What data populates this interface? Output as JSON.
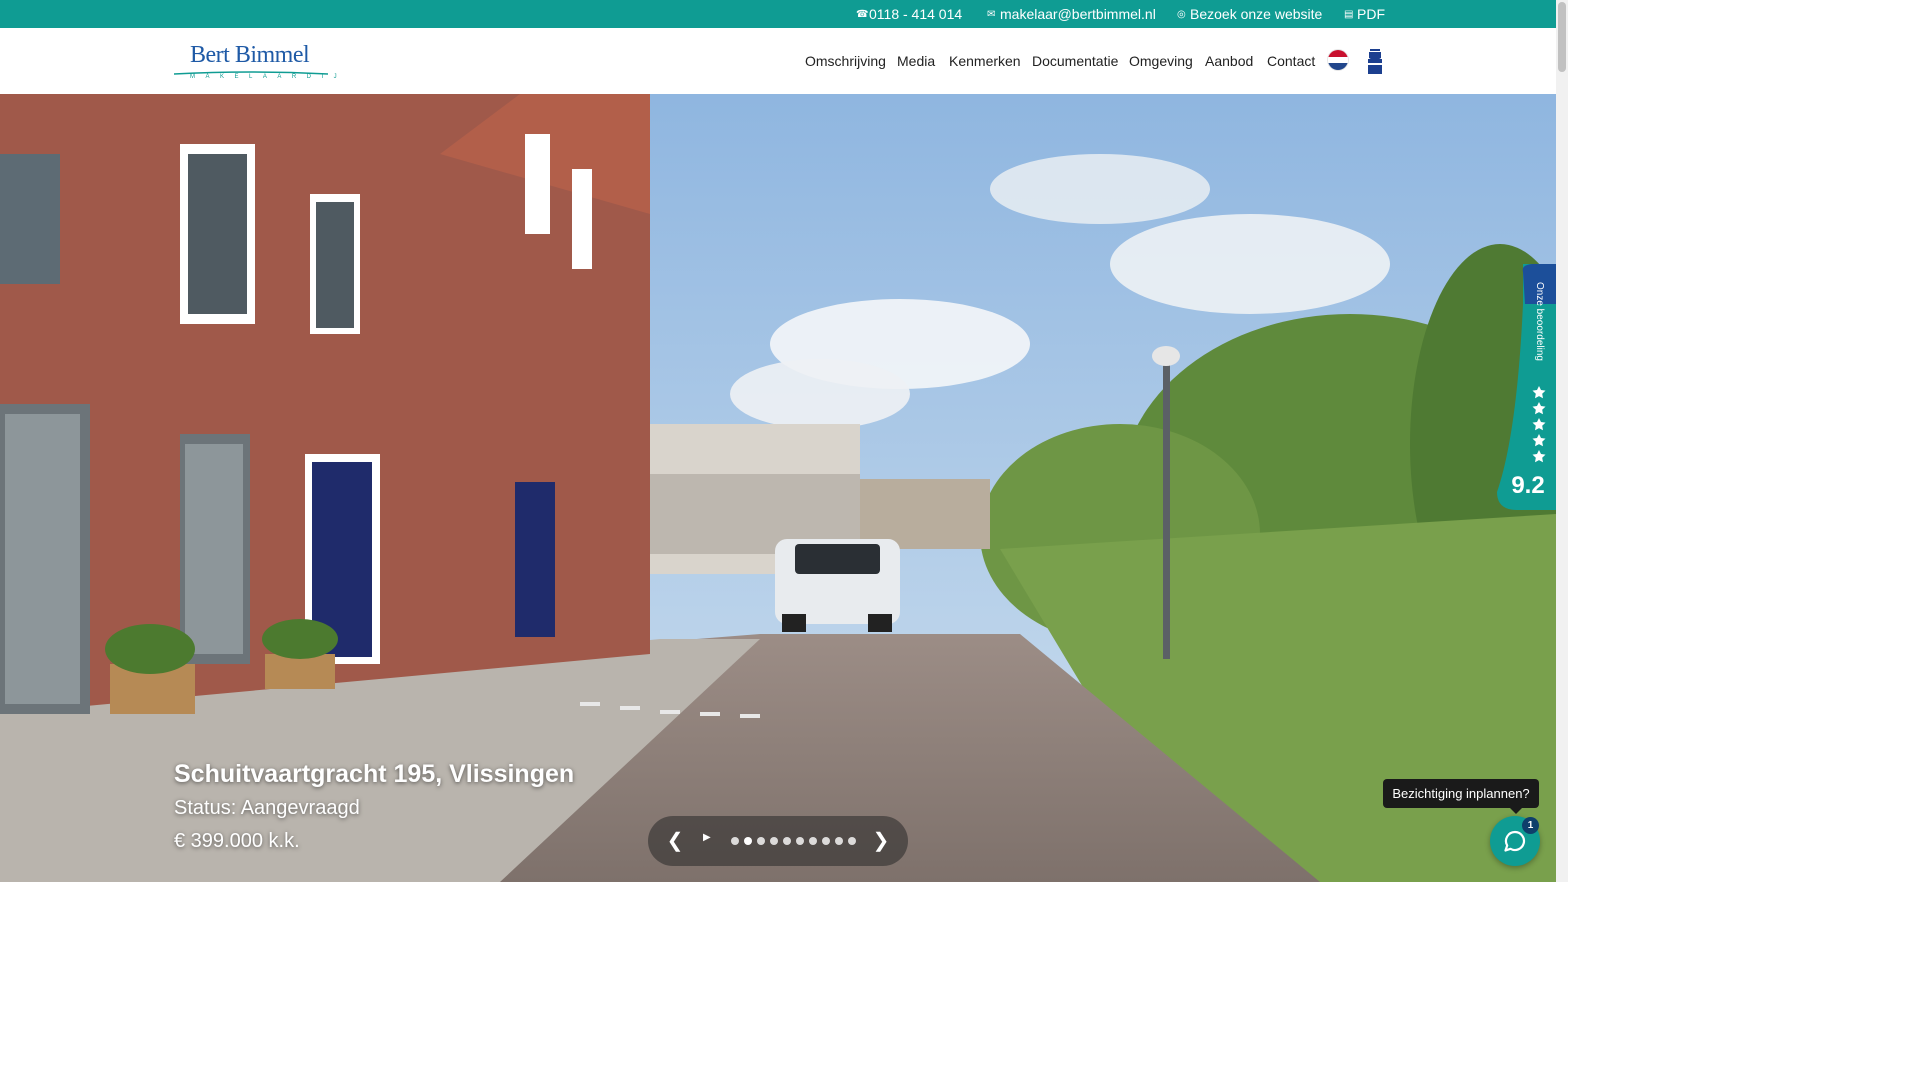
{
  "topbar": {
    "phone": "0118 - 414 014",
    "email": "makelaar@bertbimmel.nl",
    "website": "Bezoek onze website",
    "pdf": "PDF"
  },
  "brand": {
    "name": "Bert Bimmel",
    "subtitle": "MAKELAARDIJ"
  },
  "nav": {
    "items": [
      "Omschrijving",
      "Media",
      "Kenmerken",
      "Documentatie",
      "Omgeving",
      "Aanbod",
      "Contact"
    ]
  },
  "hero": {
    "title": "Schuitvaartgracht 195, Vlissingen",
    "status": "Status: Aangevraagd",
    "price": "€ 399.000 k.k.",
    "slide_count": 10,
    "active_slide": 1
  },
  "slider": {
    "prev": "❮",
    "next": "❯"
  },
  "rating": {
    "label": "Onze beoordeling",
    "score": "9.2",
    "stars": 5
  },
  "chat": {
    "tooltip": "Bezichtiging inplannen?",
    "badge": "1"
  },
  "colors": {
    "brand_teal": "#0f9c93",
    "brand_blue": "#1f5aa6",
    "nvm_blue": "#1c3f8f"
  }
}
